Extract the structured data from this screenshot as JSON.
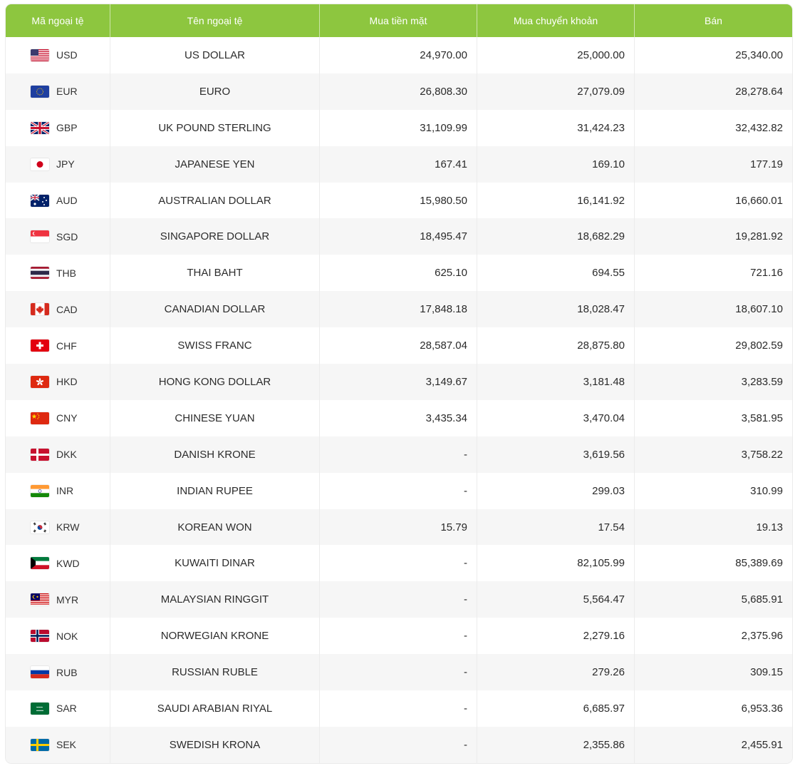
{
  "header": {
    "code": "Mã ngoại tệ",
    "name": "Tên ngoại tệ",
    "cash_buy": "Mua tiền mặt",
    "transfer_buy": "Mua chuyển khoản",
    "sell": "Bán"
  },
  "rows": [
    {
      "code": "USD",
      "name": "US DOLLAR",
      "cash": "24,970.00",
      "transfer": "25,000.00",
      "sell": "25,340.00",
      "flag": "us-flag-icon"
    },
    {
      "code": "EUR",
      "name": "EURO",
      "cash": "26,808.30",
      "transfer": "27,079.09",
      "sell": "28,278.64",
      "flag": "eu-flag-icon"
    },
    {
      "code": "GBP",
      "name": "UK POUND STERLING",
      "cash": "31,109.99",
      "transfer": "31,424.23",
      "sell": "32,432.82",
      "flag": "uk-flag-icon"
    },
    {
      "code": "JPY",
      "name": "JAPANESE YEN",
      "cash": "167.41",
      "transfer": "169.10",
      "sell": "177.19",
      "flag": "japan-flag-icon"
    },
    {
      "code": "AUD",
      "name": "AUSTRALIAN DOLLAR",
      "cash": "15,980.50",
      "transfer": "16,141.92",
      "sell": "16,660.01",
      "flag": "australia-flag-icon"
    },
    {
      "code": "SGD",
      "name": "SINGAPORE DOLLAR",
      "cash": "18,495.47",
      "transfer": "18,682.29",
      "sell": "19,281.92",
      "flag": "singapore-flag-icon"
    },
    {
      "code": "THB",
      "name": "THAI BAHT",
      "cash": "625.10",
      "transfer": "694.55",
      "sell": "721.16",
      "flag": "thailand-flag-icon"
    },
    {
      "code": "CAD",
      "name": "CANADIAN DOLLAR",
      "cash": "17,848.18",
      "transfer": "18,028.47",
      "sell": "18,607.10",
      "flag": "canada-flag-icon"
    },
    {
      "code": "CHF",
      "name": "SWISS FRANC",
      "cash": "28,587.04",
      "transfer": "28,875.80",
      "sell": "29,802.59",
      "flag": "switzerland-flag-icon"
    },
    {
      "code": "HKD",
      "name": "HONG KONG DOLLAR",
      "cash": "3,149.67",
      "transfer": "3,181.48",
      "sell": "3,283.59",
      "flag": "hong-kong-flag-icon"
    },
    {
      "code": "CNY",
      "name": "CHINESE YUAN",
      "cash": "3,435.34",
      "transfer": "3,470.04",
      "sell": "3,581.95",
      "flag": "china-flag-icon"
    },
    {
      "code": "DKK",
      "name": "DANISH KRONE",
      "cash": "-",
      "transfer": "3,619.56",
      "sell": "3,758.22",
      "flag": "denmark-flag-icon"
    },
    {
      "code": "INR",
      "name": "INDIAN RUPEE",
      "cash": "-",
      "transfer": "299.03",
      "sell": "310.99",
      "flag": "india-flag-icon"
    },
    {
      "code": "KRW",
      "name": "KOREAN WON",
      "cash": "15.79",
      "transfer": "17.54",
      "sell": "19.13",
      "flag": "korea-flag-icon"
    },
    {
      "code": "KWD",
      "name": "KUWAITI DINAR",
      "cash": "-",
      "transfer": "82,105.99",
      "sell": "85,389.69",
      "flag": "kuwait-flag-icon"
    },
    {
      "code": "MYR",
      "name": "MALAYSIAN RINGGIT",
      "cash": "-",
      "transfer": "5,564.47",
      "sell": "5,685.91",
      "flag": "malaysia-flag-icon"
    },
    {
      "code": "NOK",
      "name": "NORWEGIAN KRONE",
      "cash": "-",
      "transfer": "2,279.16",
      "sell": "2,375.96",
      "flag": "norway-flag-icon"
    },
    {
      "code": "RUB",
      "name": "RUSSIAN RUBLE",
      "cash": "-",
      "transfer": "279.26",
      "sell": "309.15",
      "flag": "russia-flag-icon"
    },
    {
      "code": "SAR",
      "name": "SAUDI ARABIAN RIYAL",
      "cash": "-",
      "transfer": "6,685.97",
      "sell": "6,953.36",
      "flag": "saudi-flag-icon"
    },
    {
      "code": "SEK",
      "name": "SWEDISH KRONA",
      "cash": "-",
      "transfer": "2,355.86",
      "sell": "2,455.91",
      "flag": "sweden-flag-icon"
    }
  ]
}
